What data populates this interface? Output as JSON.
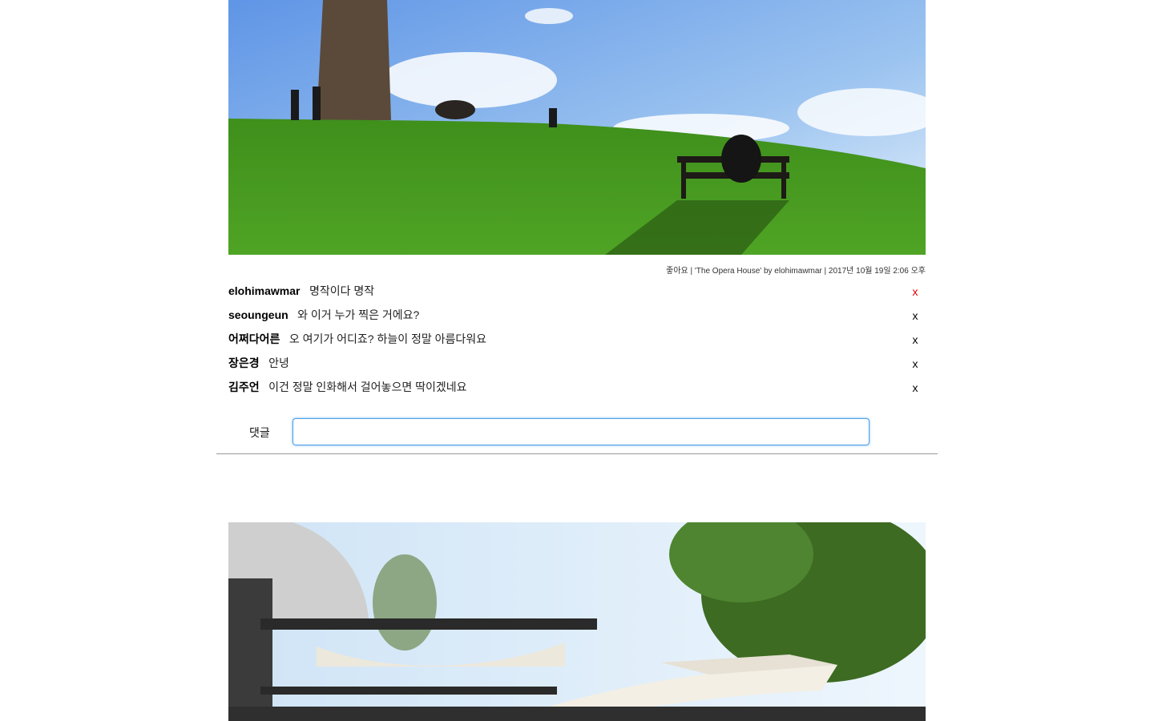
{
  "posts": [
    {
      "photo_alt": "park hill photo",
      "meta": "좋아요 | 'The Opera House' by elohimawmar | 2017년 10월 19일 2:06 오후",
      "comments": [
        {
          "author": "elohimawmar",
          "text": "명작이다 명작",
          "delete": "x",
          "delete_color": "#e00000"
        },
        {
          "author": "seoungeun",
          "text": "와 이거 누가 찍은 거에요?",
          "delete": "x"
        },
        {
          "author": "어쩌다어른",
          "text": "오 여기가 어디죠? 하늘이 정말 아름다워요",
          "delete": "x"
        },
        {
          "author": "장은경",
          "text": "안녕",
          "delete": "x"
        },
        {
          "author": "김주언",
          "text": "이건 정말 인화해서 걸어놓으면 딱이겠네요",
          "delete": "x"
        }
      ],
      "comment_form": {
        "label": "댓글",
        "value": ""
      }
    },
    {
      "photo_alt": "outdoor cafe photo"
    }
  ]
}
